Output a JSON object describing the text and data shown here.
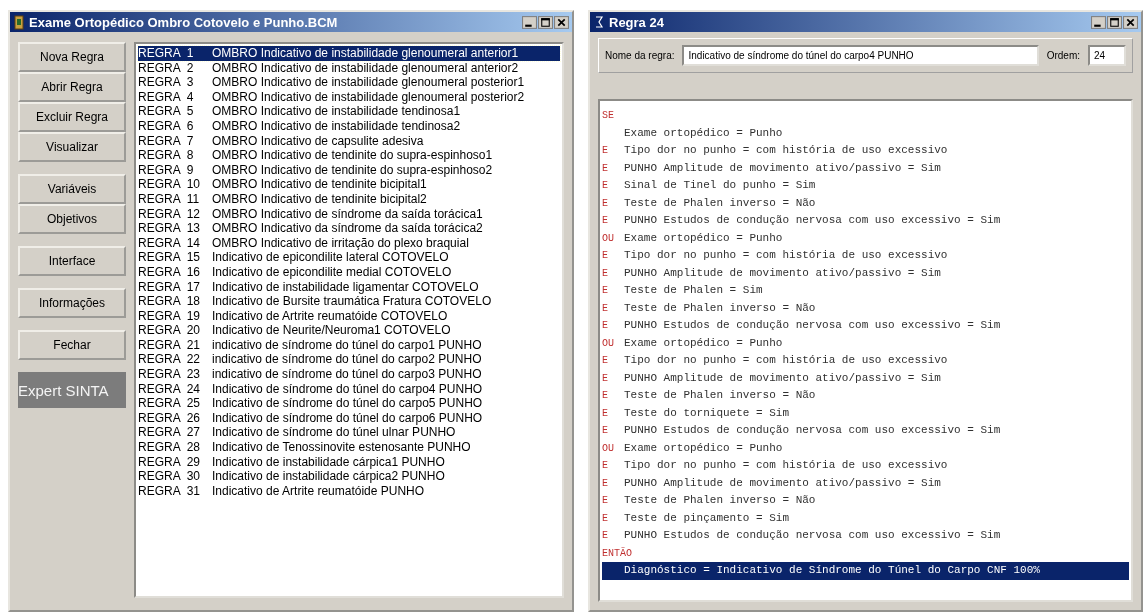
{
  "main_window": {
    "title": "Exame Ortopédico Ombro Cotovelo e Punho.BCM",
    "button_groups": [
      [
        "Nova Regra",
        "Abrir Regra",
        "Excluir Regra",
        "Visualizar"
      ],
      [
        "Variáveis",
        "Objetivos"
      ],
      [
        "Interface"
      ],
      [
        "Informações"
      ],
      [
        "Fechar"
      ]
    ],
    "brand": "Expert SINTA",
    "rules": [
      {
        "rule": "REGRA  1",
        "name": "OMBRO Indicativo de instabilidade glenoumeral anterior1",
        "selected": true
      },
      {
        "rule": "REGRA  2",
        "name": "OMBRO Indicativo de instabilidade glenoumeral anterior2",
        "selected": false
      },
      {
        "rule": "REGRA  3",
        "name": "OMBRO Indicativo de instabilidade glenoumeral posterior1",
        "selected": false
      },
      {
        "rule": "REGRA  4",
        "name": "OMBRO Indicativo de instabilidade glenoumeral posterior2",
        "selected": false
      },
      {
        "rule": "REGRA  5",
        "name": "OMBRO Indicativo de instabilidade tendinosa1",
        "selected": false
      },
      {
        "rule": "REGRA  6",
        "name": "OMBRO Indicativo de instabilidade tendinosa2",
        "selected": false
      },
      {
        "rule": "REGRA  7",
        "name": "OMBRO Indicativo de capsulite adesiva",
        "selected": false
      },
      {
        "rule": "REGRA  8",
        "name": "OMBRO Indicativo de tendinite do supra-espinhoso1",
        "selected": false
      },
      {
        "rule": "REGRA  9",
        "name": "OMBRO Indicativo de tendinite do supra-espinhoso2",
        "selected": false
      },
      {
        "rule": "REGRA  10",
        "name": "OMBRO Indicativo de tendinite bicipital1",
        "selected": false
      },
      {
        "rule": "REGRA  11",
        "name": "OMBRO Indicativo de tendinite bicipital2",
        "selected": false
      },
      {
        "rule": "REGRA  12",
        "name": "OMBRO Indicativo de síndrome da saída torácica1",
        "selected": false
      },
      {
        "rule": "REGRA  13",
        "name": "OMBRO Indicativo da síndrome da saída torácica2",
        "selected": false
      },
      {
        "rule": "REGRA  14",
        "name": "OMBRO Indicativo de irritação do plexo braquial",
        "selected": false
      },
      {
        "rule": "REGRA  15",
        "name": "Indicativo de epicondilite lateral COTOVELO",
        "selected": false
      },
      {
        "rule": "REGRA  16",
        "name": "Indicativo de epicondilite medial COTOVELO",
        "selected": false
      },
      {
        "rule": "REGRA  17",
        "name": "Indicativo de instabilidade ligamentar COTOVELO",
        "selected": false
      },
      {
        "rule": "REGRA  18",
        "name": "Indicativo de Bursite traumática Fratura COTOVELO",
        "selected": false
      },
      {
        "rule": "REGRA  19",
        "name": "Indicativo de Artrite reumatóide COTOVELO",
        "selected": false
      },
      {
        "rule": "REGRA  20",
        "name": "Indicativo de Neurite/Neuroma1 COTOVELO",
        "selected": false
      },
      {
        "rule": "REGRA  21",
        "name": "indicativo de síndrome do túnel do carpo1 PUNHO",
        "selected": false
      },
      {
        "rule": "REGRA  22",
        "name": "indicativo de síndrome do túnel do carpo2 PUNHO",
        "selected": false
      },
      {
        "rule": "REGRA  23",
        "name": "indicativo de síndrome do túnel do carpo3 PUNHO",
        "selected": false
      },
      {
        "rule": "REGRA  24",
        "name": "Indicativo de síndrome do túnel do carpo4 PUNHO",
        "selected": false
      },
      {
        "rule": "REGRA  25",
        "name": "Indicativo de síndrome do túnel do carpo5 PUNHO",
        "selected": false
      },
      {
        "rule": "REGRA  26",
        "name": "Indicativo de síndrome do túnel do carpo6 PUNHO",
        "selected": false
      },
      {
        "rule": "REGRA  27",
        "name": "Indicativo de síndrome do túnel ulnar PUNHO",
        "selected": false
      },
      {
        "rule": "REGRA  28",
        "name": "Indicativo de Tenossinovite estenosante PUNHO",
        "selected": false
      },
      {
        "rule": "REGRA  29",
        "name": "Indicativo de instabilidade cárpica1 PUNHO",
        "selected": false
      },
      {
        "rule": "REGRA  30",
        "name": "Indicativo de instabilidade cárpica2 PUNHO",
        "selected": false
      },
      {
        "rule": "REGRA  31",
        "name": "Indicativo de Artrite reumatóide PUNHO",
        "selected": false
      }
    ]
  },
  "rule_window": {
    "title": "Regra 24",
    "name_label": "Nome da regra:",
    "name_value": "Indicativo de síndrome do túnel do carpo4 PUNHO",
    "order_label": "Ordem:",
    "order_value": "24",
    "lines": [
      {
        "prefix": "SE",
        "selected": false
      },
      {
        "text": "Exame ortopédico = Punho",
        "selected": false
      },
      {
        "prefix": "E",
        "text": "Tipo dor no punho = com história de uso excessivo",
        "selected": false
      },
      {
        "prefix": "E",
        "text": "PUNHO Amplitude de movimento ativo/passivo = Sim",
        "selected": false
      },
      {
        "prefix": "E",
        "text": "Sinal de Tinel do punho = Sim",
        "selected": false
      },
      {
        "prefix": "E",
        "text": "Teste de Phalen inverso = Não",
        "selected": false
      },
      {
        "prefix": "E",
        "text": "PUNHO Estudos de condução nervosa com uso excessivo = Sim",
        "selected": false
      },
      {
        "prefix": "OU",
        "text": "Exame ortopédico = Punho",
        "selected": false
      },
      {
        "prefix": "E",
        "text": "Tipo dor no punho = com história de uso excessivo",
        "selected": false
      },
      {
        "prefix": "E",
        "text": "PUNHO Amplitude de movimento ativo/passivo = Sim",
        "selected": false
      },
      {
        "prefix": "E",
        "text": "Teste de Phalen = Sim",
        "selected": false
      },
      {
        "prefix": "E",
        "text": "Teste de Phalen inverso = Não",
        "selected": false
      },
      {
        "prefix": "E",
        "text": "PUNHO Estudos de condução nervosa com uso excessivo = Sim",
        "selected": false
      },
      {
        "prefix": "OU",
        "text": "Exame ortopédico = Punho",
        "selected": false
      },
      {
        "prefix": "E",
        "text": "Tipo dor no punho = com história de uso excessivo",
        "selected": false
      },
      {
        "prefix": "E",
        "text": "PUNHO Amplitude de movimento ativo/passivo = Sim",
        "selected": false
      },
      {
        "prefix": "E",
        "text": "Teste de Phalen inverso = Não",
        "selected": false
      },
      {
        "prefix": "E",
        "text": "Teste do torniquete = Sim",
        "selected": false
      },
      {
        "prefix": "E",
        "text": "PUNHO Estudos de condução nervosa com uso excessivo = Sim",
        "selected": false
      },
      {
        "prefix": "OU",
        "text": "Exame ortopédico = Punho",
        "selected": false
      },
      {
        "prefix": "E",
        "text": "Tipo dor no punho = com história de uso excessivo",
        "selected": false
      },
      {
        "prefix": "E",
        "text": "PUNHO Amplitude de movimento ativo/passivo = Sim",
        "selected": false
      },
      {
        "prefix": "E",
        "text": "Teste de Phalen inverso = Não",
        "selected": false
      },
      {
        "prefix": "E",
        "text": "Teste de pinçamento = Sim",
        "selected": false
      },
      {
        "prefix": "E",
        "text": "PUNHO Estudos de condução nervosa com uso excessivo = Sim",
        "selected": false
      },
      {
        "prefix": "ENTÃO",
        "selected": false
      },
      {
        "text": "Diagnóstico = Indicativo de Síndrome do Túnel do Carpo CNF 100%",
        "selected": true
      }
    ]
  }
}
